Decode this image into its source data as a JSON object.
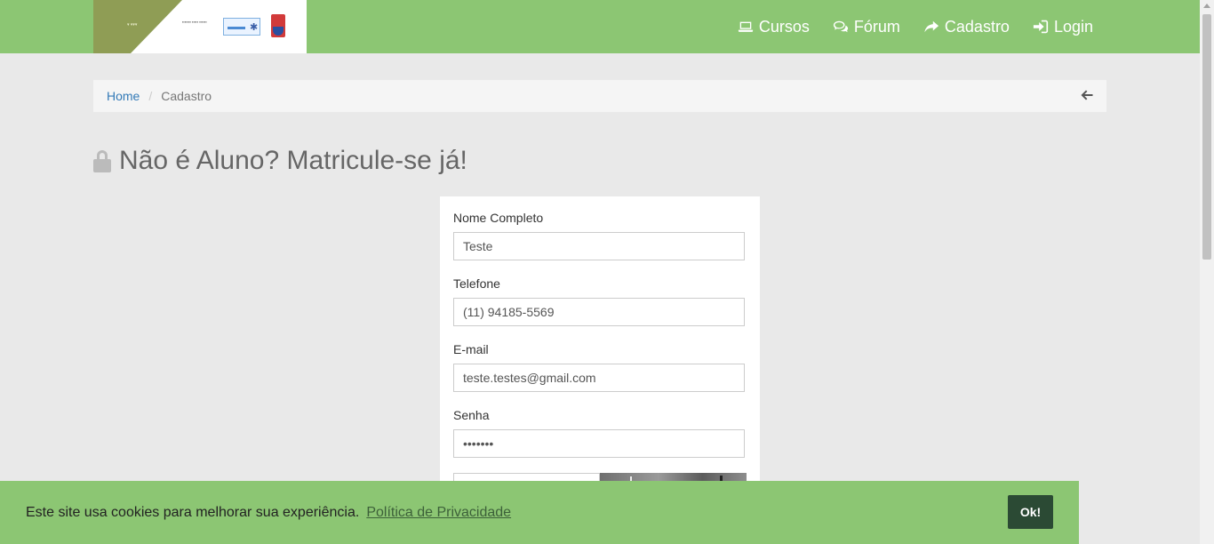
{
  "header": {
    "nav": [
      {
        "label": "Cursos",
        "icon": "laptop-icon"
      },
      {
        "label": "Fórum",
        "icon": "comments-icon"
      },
      {
        "label": "Cadastro",
        "icon": "share-icon"
      },
      {
        "label": "Login",
        "icon": "sign-in-icon"
      }
    ],
    "colors": {
      "bar": "#8cc673"
    }
  },
  "breadcrumb": {
    "home": "Home",
    "separator": "/",
    "current": "Cadastro",
    "back_icon": "arrow-left-icon"
  },
  "page": {
    "title": "Não é Aluno? Matricule-se já!",
    "title_icon": "lock-icon"
  },
  "form": {
    "fields": [
      {
        "label": "Nome Completo",
        "value": "Teste"
      },
      {
        "label": "Telefone",
        "value": "(11) 94185-5569"
      },
      {
        "label": "E-mail",
        "value": "teste.testes@gmail.com"
      },
      {
        "label": "Senha",
        "value": "•••••••"
      }
    ]
  },
  "cookie": {
    "message": "Este site usa cookies para melhorar sua experiência.",
    "policy_link": "Política de Privacidade",
    "ok_label": "Ok!"
  }
}
